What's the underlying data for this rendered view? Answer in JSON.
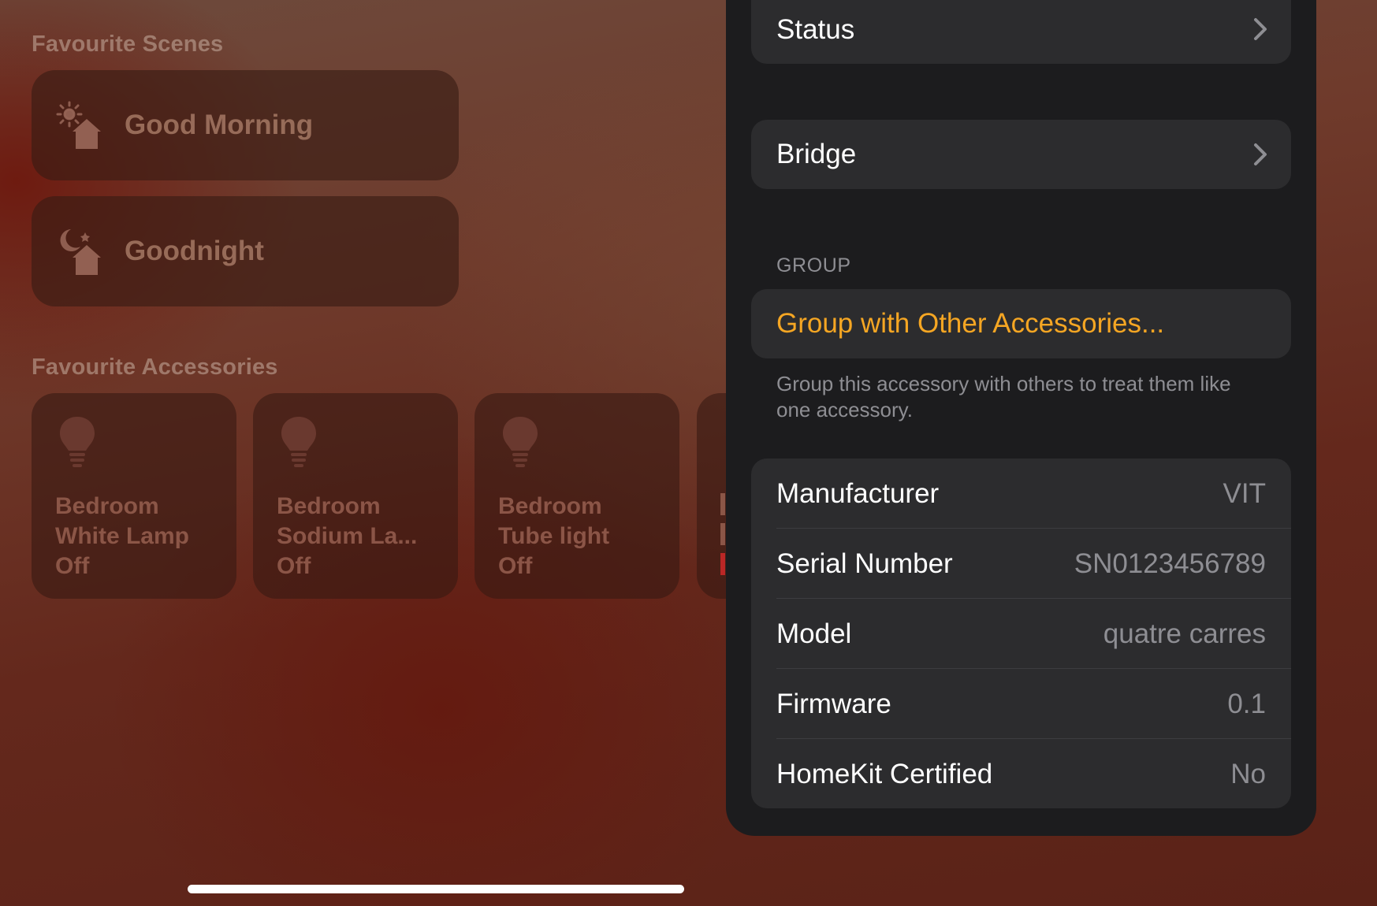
{
  "home": {
    "scenes_title": "Favourite Scenes",
    "scenes": [
      {
        "label": "Good Morning",
        "icon": "sun-house-icon"
      },
      {
        "label": "Goodnight",
        "icon": "moon-house-icon"
      }
    ],
    "accessories_title": "Favourite Accessories",
    "accessories": [
      {
        "line1": "Bedroom",
        "line2": "White Lamp",
        "status": "Off",
        "icon": "lightbulb-icon"
      },
      {
        "line1": "Bedroom",
        "line2": "Sodium La...",
        "status": "Off",
        "icon": "lightbulb-icon"
      },
      {
        "line1": "Bedroom",
        "line2": "Tube light",
        "status": "Off",
        "icon": "lightbulb-icon"
      }
    ]
  },
  "sheet": {
    "status_label": "Status",
    "bridge_label": "Bridge",
    "group_header": "GROUP",
    "group_action": "Group with Other Accessories...",
    "group_footnote": "Group this accessory with others to treat them like one accessory.",
    "info": [
      {
        "key": "Manufacturer",
        "value": "VIT"
      },
      {
        "key": "Serial Number",
        "value": "SN0123456789"
      },
      {
        "key": "Model",
        "value": "quatre carres"
      },
      {
        "key": "Firmware",
        "value": "0.1"
      },
      {
        "key": "HomeKit Certified",
        "value": "No"
      }
    ]
  },
  "colors": {
    "accent": "#f5a623",
    "sheet_bg": "#1c1c1e",
    "card_bg": "#2c2c2e",
    "secondary_text": "#8e8e93"
  }
}
